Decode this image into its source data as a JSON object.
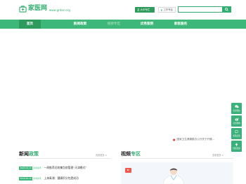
{
  "header": {
    "site_name": "家医网",
    "site_url": "www.grdoc.org",
    "expert_button": "大众专栏",
    "workspace_button": "工作专区",
    "search_placeholder": ""
  },
  "nav": {
    "items": [
      {
        "label": "首页"
      },
      {
        "label": "新闻政策"
      },
      {
        "label": "视频专区"
      },
      {
        "label": "优秀案例"
      },
      {
        "label": "家医服务"
      }
    ]
  },
  "ticker": {
    "text": "国家卫生健康委办公厅关于开展..."
  },
  "side_toolbar": {
    "items": [
      {
        "label": "官方微信"
      },
      {
        "label": "官方微博"
      },
      {
        "label": "意见反馈"
      },
      {
        "label": "回到顶部"
      }
    ]
  },
  "news": {
    "title_prefix": "新闻",
    "title_highlight": "政策",
    "more": "查看更多 >",
    "items": [
      {
        "date": "2020-10-11",
        "tag": "新闻资讯",
        "text": "一周推荐近收集包房管理“天津模式”"
      },
      {
        "date": "2020-10-11",
        "tag": "新闻资讯",
        "text": "上海青浦：健康积分包提成功"
      }
    ]
  },
  "video": {
    "title_prefix": "视频",
    "title_highlight": "专区",
    "more": "查看更多 >"
  },
  "colors": {
    "brand_green": "#3db87a",
    "dark_green": "#2e9a5c",
    "ticker_dot": "#e03030"
  }
}
